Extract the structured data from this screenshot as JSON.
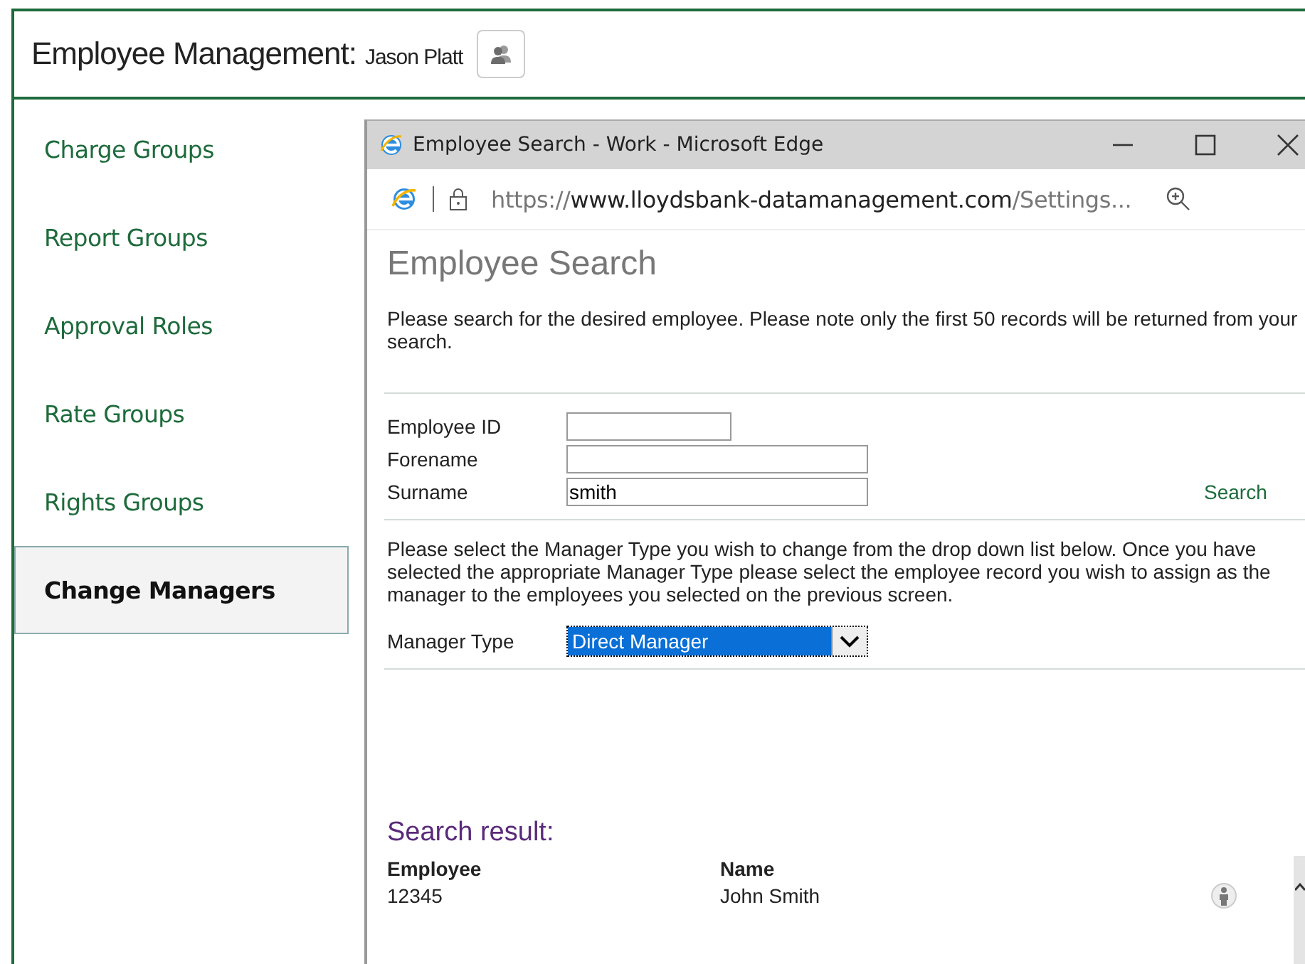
{
  "header": {
    "title": "Employee Management:",
    "user": "Jason Platt"
  },
  "sidebar": {
    "items": [
      {
        "label": "Charge Groups",
        "selected": false
      },
      {
        "label": "Report Groups",
        "selected": false
      },
      {
        "label": "Approval Roles",
        "selected": false
      },
      {
        "label": "Rate Groups",
        "selected": false
      },
      {
        "label": "Rights Groups",
        "selected": false
      },
      {
        "label": "Change Managers",
        "selected": true
      }
    ]
  },
  "browser": {
    "title": "Employee Search - Work - Microsoft Edge",
    "url_scheme": "https://",
    "url_host": "www.lloydsbank-datamanagement.com",
    "url_path": "/Settings..."
  },
  "page": {
    "heading": "Employee Search",
    "intro": "Please search for the desired employee. Please note only the first 50 records will be returned from your search.",
    "fields": [
      {
        "label": "Employee ID",
        "kind": "short"
      },
      {
        "label": "Forename",
        "kind": "long"
      },
      {
        "label": "Surname",
        "kind": "long",
        "value": "smith"
      }
    ],
    "search_link": "Search",
    "manager_text": "Please select the Manager Type you wish to change from the drop down list below. Once you have selected the appropriate Manager Type please select the employee record you wish to assign as the manager to the employees you selected on the previous screen.",
    "manager_type": {
      "label": "Manager Type",
      "value": "Direct Manager"
    },
    "results": {
      "title": "Search result:",
      "columns": [
        "Employee",
        "Name"
      ],
      "rows": [
        {
          "employee": "12345",
          "name": "John Smith"
        }
      ]
    }
  }
}
